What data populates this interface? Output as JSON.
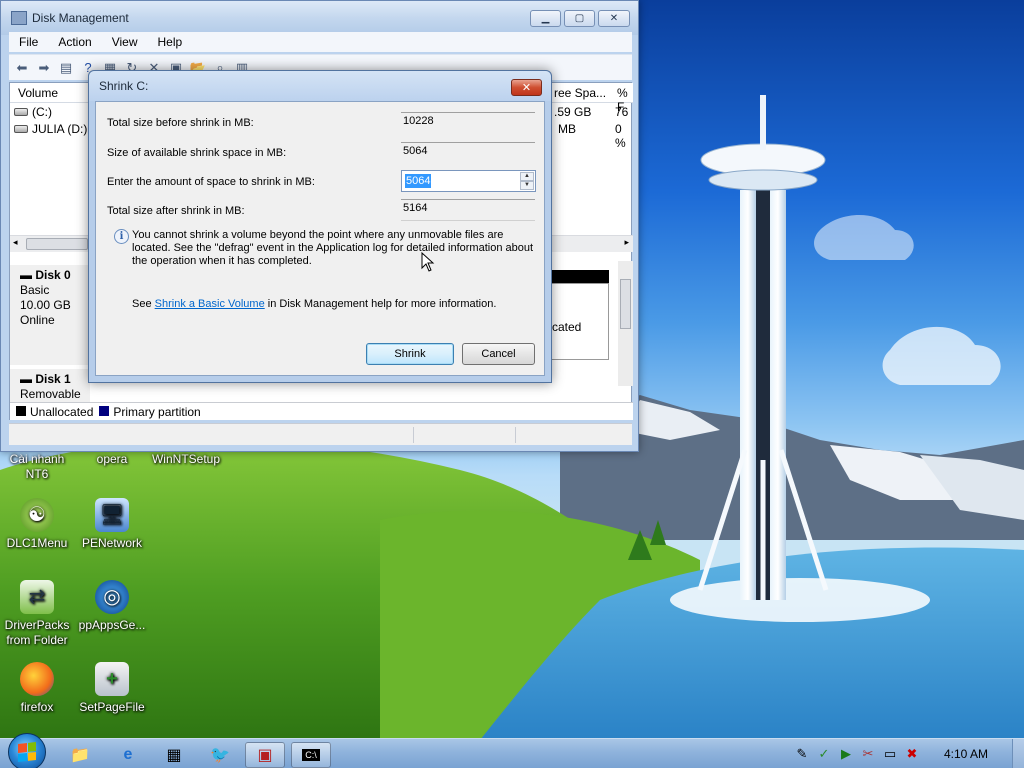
{
  "colors": {
    "unallocated": "#000000",
    "primary_partition": "#00007f",
    "link": "#0066cc",
    "selection": "#3399ff"
  },
  "desktop": {
    "icons": [
      {
        "label": "Cài nhanh\nNT6",
        "icon": "installer-icon"
      },
      {
        "label": "opera",
        "icon": "opera-icon"
      },
      {
        "label": "WinNTSetup",
        "icon": "setup-icon"
      },
      {
        "label": "DLC1Menu",
        "icon": "dlc-icon"
      },
      {
        "label": "PENetwork",
        "icon": "network-icon"
      },
      {
        "label": "DriverPacks\nfrom Folder",
        "icon": "driverpacks-icon"
      },
      {
        "label": "ppAppsGe...",
        "icon": "ppapps-icon"
      },
      {
        "label": "firefox",
        "icon": "firefox-icon"
      },
      {
        "label": "SetPageFile",
        "icon": "pagefile-icon"
      }
    ]
  },
  "window": {
    "title": "Disk Management",
    "menu": [
      "File",
      "Action",
      "View",
      "Help"
    ],
    "volume_header": {
      "volume": "Volume",
      "free_space": "ree Spa...",
      "percent_free": "% F"
    },
    "volumes": [
      {
        "name": "(C:)",
        "free": ".59 GB",
        "pct": "76"
      },
      {
        "name": "JULIA (D:)",
        "free": "MB",
        "pct": "0 %"
      }
    ],
    "disks": [
      {
        "name": "Disk 0",
        "type": "Basic",
        "size": "10.00 GB",
        "status": "Online",
        "partition_tail": "cated"
      },
      {
        "name": "Disk 1",
        "type": "Removable (E:)"
      }
    ],
    "legend": {
      "unallocated": "Unallocated",
      "primary": "Primary partition"
    }
  },
  "dialog": {
    "title": "Shrink C:",
    "rows": {
      "total_before_label": "Total size before shrink in MB:",
      "total_before_value": "10228",
      "available_label": "Size of available shrink space in MB:",
      "available_value": "5064",
      "amount_label": "Enter the amount of space to shrink in MB:",
      "amount_value": "5064",
      "total_after_label": "Total size after shrink in MB:",
      "total_after_value": "5164"
    },
    "info": "You cannot shrink a volume beyond the point where any unmovable files are located. See the \"defrag\" event in the Application log for detailed information about the operation when it has completed.",
    "help_prefix": "See ",
    "help_link": "Shrink a Basic Volume",
    "help_suffix": " in Disk Management help for more information.",
    "shrink_button": "Shrink",
    "cancel_button": "Cancel"
  },
  "taskbar": {
    "clock": "4:10 AM"
  }
}
